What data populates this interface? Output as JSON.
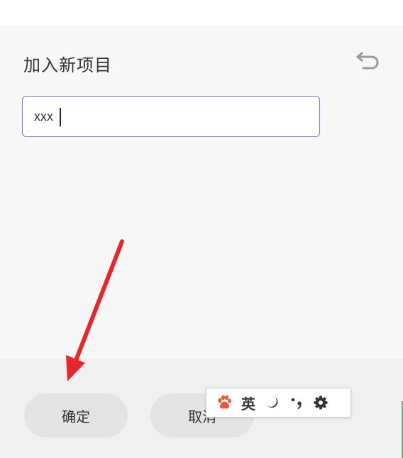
{
  "dialog": {
    "title": "加入新项目",
    "back_icon": "undo-arrow-icon",
    "input": {
      "value": "xxx",
      "placeholder": ""
    },
    "confirm_label": "确定",
    "cancel_label": "取消"
  },
  "ime_toolbar": {
    "logo_icon": "paw-icon",
    "language": "英",
    "moon_icon": "moon-icon",
    "punctuation_icon": "punctuation-icon",
    "settings_icon": "gear-icon"
  },
  "annotation": {
    "arrow_color": "#e8262b"
  },
  "colors": {
    "input_border": "#6f77e3",
    "button_bg": "#e3e3e3",
    "ime_logo": "#e65a3c"
  }
}
